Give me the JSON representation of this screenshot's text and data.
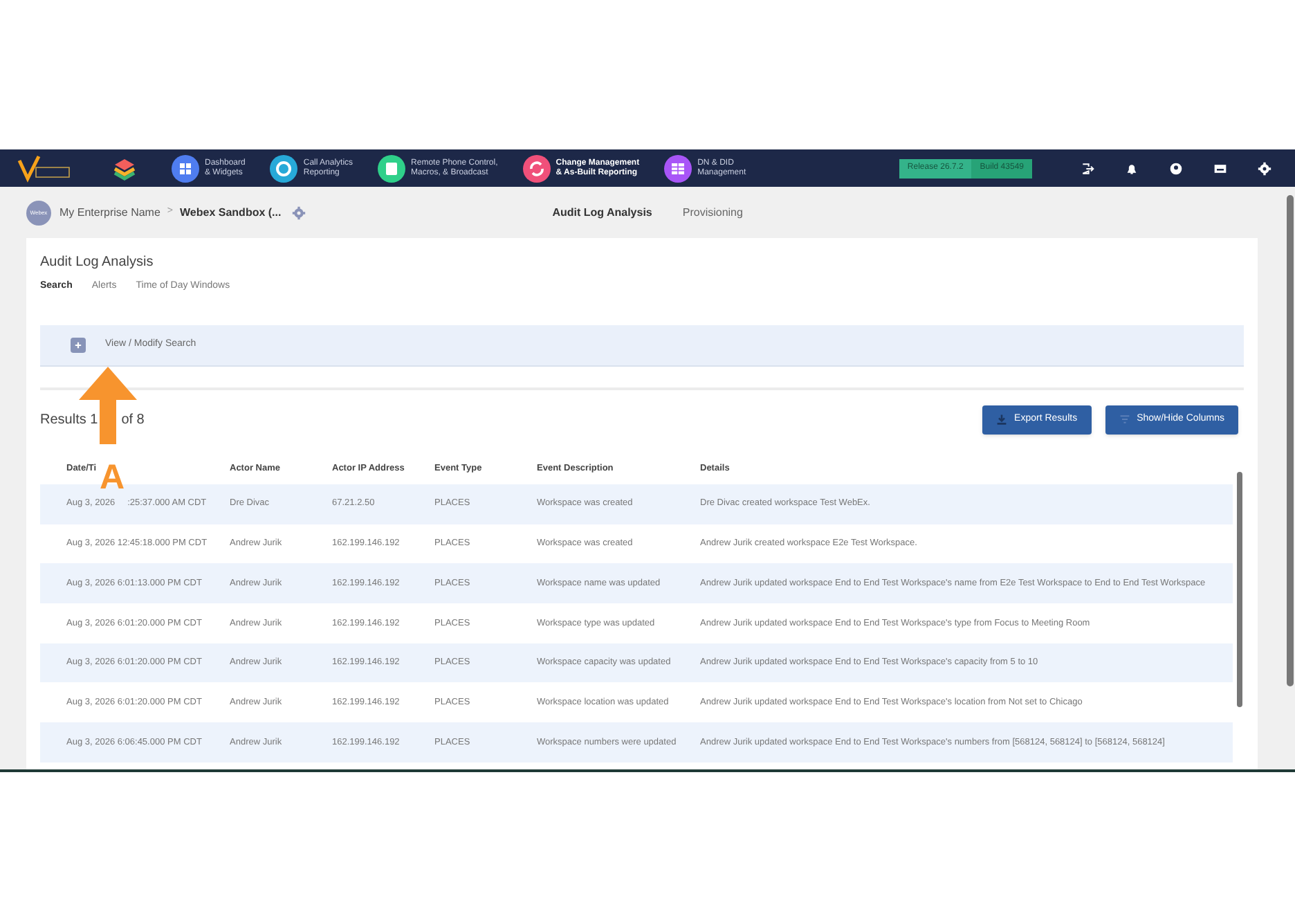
{
  "nav": {
    "items": [
      {
        "label": "Dashboard\n& Widgets",
        "kind": "grid",
        "color": "#4f7df0",
        "selected": false
      },
      {
        "label": "Call Analytics\nReporting",
        "kind": "ring",
        "color": "#27a9d8",
        "selected": false
      },
      {
        "label": "Remote Phone Control,\nMacros, & Broadcast",
        "kind": "phone",
        "color": "#2fd08a",
        "selected": false
      },
      {
        "label": "Change Management\n& As-Built Reporting",
        "kind": "cycle",
        "color": "#f0507a",
        "selected": true
      },
      {
        "label": "DN & DID\nManagement",
        "kind": "table",
        "color": "#a855f7",
        "selected": false
      }
    ],
    "release": "Release 26.7.2",
    "build": "Build 43549"
  },
  "breadcrumb": {
    "avatar": "Webex",
    "enterprise": "My Enterprise Name",
    "separator": ">",
    "site": "Webex Sandbox (..."
  },
  "top_tabs": [
    {
      "label": "Audit Log Analysis",
      "selected": true
    },
    {
      "label": "Provisioning",
      "selected": false
    }
  ],
  "page_title": "Audit Log Analysis",
  "tabs": [
    {
      "label": "Search",
      "selected": true
    },
    {
      "label": "Alerts",
      "selected": false
    },
    {
      "label": "Time of Day Windows",
      "selected": false
    }
  ],
  "search_panel": {
    "label": "View / Modify Search",
    "expanded": false
  },
  "results": [
    "Results 1",
    "of 8"
  ],
  "buttons": [
    {
      "label": "Export Results",
      "kind": "export"
    },
    {
      "label": "Show/Hide Columns",
      "kind": "filter"
    }
  ],
  "table": {
    "columns": [
      "Date/Ti",
      "Actor Name",
      "Actor IP Address",
      "Event Type",
      "Event Description",
      "Details"
    ],
    "rows": [
      {
        "date": [
          "Aug 3, 2026",
          ":25:37.000 AM CDT"
        ],
        "actor": "Dre Divac",
        "ip": "67.21.2.50",
        "type": "PLACES",
        "description": "Workspace was created",
        "details": "Dre Divac created workspace Test WebEx."
      },
      {
        "date": [
          "Aug 3, 2026 12:45:18.000 PM CDT"
        ],
        "actor": "Andrew Jurik",
        "ip": "162.199.146.192",
        "type": "PLACES",
        "description": "Workspace was created",
        "details": "Andrew Jurik created workspace E2e Test Workspace."
      },
      {
        "date": [
          "Aug 3, 2026 6:01:13.000 PM CDT"
        ],
        "actor": "Andrew Jurik",
        "ip": "162.199.146.192",
        "type": "PLACES",
        "description": "Workspace name was updated",
        "details": "Andrew Jurik updated workspace End to End Test Workspace's name from E2e Test Workspace to End to End Test Workspace"
      },
      {
        "date": [
          "Aug 3, 2026 6:01:20.000 PM CDT"
        ],
        "actor": "Andrew Jurik",
        "ip": "162.199.146.192",
        "type": "PLACES",
        "description": "Workspace type was updated",
        "details": "Andrew Jurik updated workspace End to End Test Workspace's type from Focus to Meeting Room"
      },
      {
        "date": [
          "Aug 3, 2026 6:01:20.000 PM CDT"
        ],
        "actor": "Andrew Jurik",
        "ip": "162.199.146.192",
        "type": "PLACES",
        "description": "Workspace capacity was updated",
        "details": "Andrew Jurik updated workspace End to End Test Workspace's capacity from 5 to 10"
      },
      {
        "date": [
          "Aug 3, 2026 6:01:20.000 PM CDT"
        ],
        "actor": "Andrew Jurik",
        "ip": "162.199.146.192",
        "type": "PLACES",
        "description": "Workspace location was updated",
        "details": "Andrew Jurik updated workspace End to End Test Workspace's location from Not set to Chicago"
      },
      {
        "date": [
          "Aug 3, 2026 6:06:45.000 PM CDT"
        ],
        "actor": "Andrew Jurik",
        "ip": "162.199.146.192",
        "type": "PLACES",
        "description": "Workspace numbers were updated",
        "details": "Andrew Jurik updated workspace End to End Test Workspace's numbers from [568124, 568124] to [568124, 568124]"
      }
    ]
  },
  "annotation": {
    "label": "A"
  }
}
